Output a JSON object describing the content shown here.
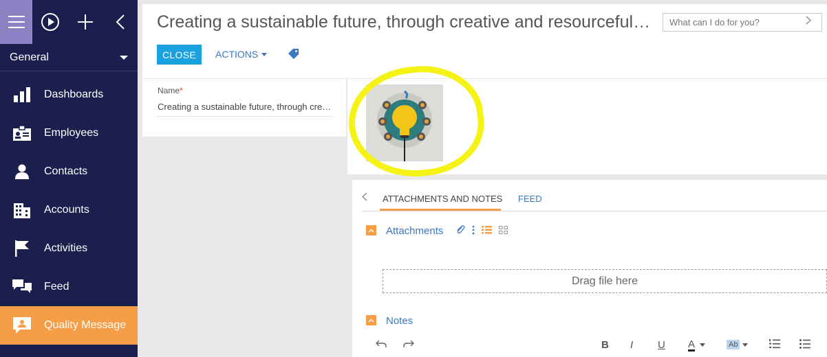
{
  "sidebar": {
    "section": "General",
    "items": [
      {
        "label": "Dashboards",
        "icon": "bar-chart-icon"
      },
      {
        "label": "Employees",
        "icon": "id-card-icon"
      },
      {
        "label": "Contacts",
        "icon": "person-icon"
      },
      {
        "label": "Accounts",
        "icon": "building-icon"
      },
      {
        "label": "Activities",
        "icon": "flag-icon"
      },
      {
        "label": "Feed",
        "icon": "chat-icon"
      },
      {
        "label": "Quality Message",
        "icon": "quality-message-icon"
      }
    ],
    "active_index": 6
  },
  "header": {
    "title": "Creating a sustainable future, through creative and resourceful solutions",
    "search_placeholder": "What can I do for you?",
    "close_label": "CLOSE",
    "actions_label": "ACTIONS"
  },
  "name_field": {
    "label": "Name",
    "value": "Creating a sustainable future, through creative and resourceful solutions"
  },
  "tabs": {
    "items": [
      {
        "label": "ATTACHMENTS AND NOTES",
        "active": true
      },
      {
        "label": "FEED",
        "active": false
      }
    ]
  },
  "attachments": {
    "title": "Attachments",
    "drop_text": "Drag file here"
  },
  "notes": {
    "title": "Notes",
    "toolbar": {
      "bold": "B",
      "italic": "I",
      "underline": "U",
      "font_color": "A",
      "highlight": "Ab"
    }
  },
  "colors": {
    "sidebar_bg": "#1b1f4e",
    "accent": "#f59d47",
    "primary_button": "#1aa1e0",
    "link": "#3a78c2",
    "highlight_annotation": "#f5f216"
  }
}
